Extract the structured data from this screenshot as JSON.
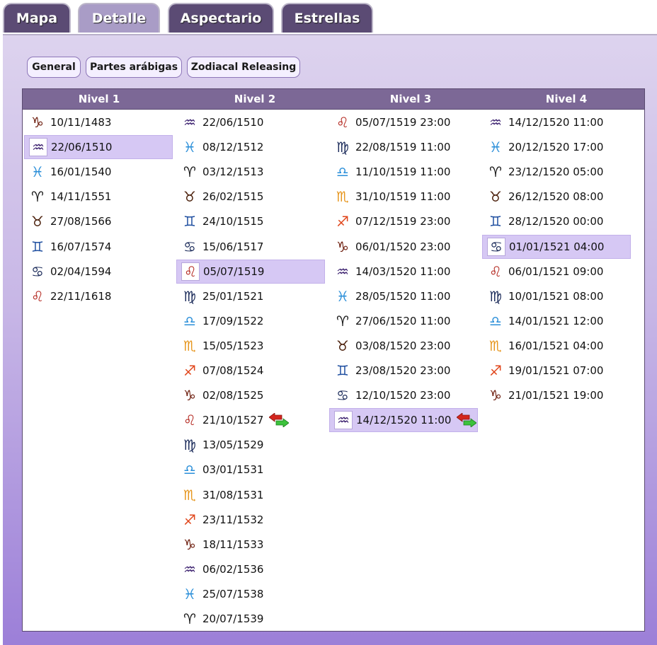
{
  "tabs": [
    {
      "label": "Mapa",
      "active": false
    },
    {
      "label": "Detalle",
      "active": true
    },
    {
      "label": "Aspectario",
      "active": false
    },
    {
      "label": "Estrellas",
      "active": false
    }
  ],
  "subtabs": [
    "General",
    "Partes arábigas",
    "Zodiacal Releasing"
  ],
  "columns": [
    "Nivel 1",
    "Nivel 2",
    "Nivel 3",
    "Nivel 4"
  ],
  "signs": {
    "capricorn": {
      "glyph": "♑",
      "color": "#6b1a0a"
    },
    "aquarius": {
      "glyph": "♒",
      "color": "#3a1f6e"
    },
    "pisces": {
      "glyph": "♓",
      "color": "#2b8fd9"
    },
    "aries": {
      "glyph": "♈",
      "color": "#1a1a1a"
    },
    "taurus": {
      "glyph": "♉",
      "color": "#4a1f0a"
    },
    "gemini": {
      "glyph": "♊",
      "color": "#1f4fa0"
    },
    "cancer": {
      "glyph": "♋",
      "color": "#1b2b5a"
    },
    "leo": {
      "glyph": "♌",
      "color": "#b3261e"
    },
    "virgo": {
      "glyph": "♍",
      "color": "#1b2b5a"
    },
    "libra": {
      "glyph": "♎",
      "color": "#2b8fd9"
    },
    "scorpio": {
      "glyph": "♏",
      "color": "#e6951c"
    },
    "sagittarius": {
      "glyph": "♐",
      "color": "#e0451a"
    }
  },
  "nivel1": [
    {
      "sign": "capricorn",
      "date": "10/11/1483"
    },
    {
      "sign": "aquarius",
      "date": "22/06/1510",
      "selected": true
    },
    {
      "sign": "pisces",
      "date": "16/01/1540"
    },
    {
      "sign": "aries",
      "date": "14/11/1551"
    },
    {
      "sign": "taurus",
      "date": "27/08/1566"
    },
    {
      "sign": "gemini",
      "date": "16/07/1574"
    },
    {
      "sign": "cancer",
      "date": "02/04/1594"
    },
    {
      "sign": "leo",
      "date": "22/11/1618"
    }
  ],
  "nivel2": [
    {
      "sign": "aquarius",
      "date": "22/06/1510"
    },
    {
      "sign": "pisces",
      "date": "08/12/1512"
    },
    {
      "sign": "aries",
      "date": "03/12/1513"
    },
    {
      "sign": "taurus",
      "date": "26/02/1515"
    },
    {
      "sign": "gemini",
      "date": "24/10/1515"
    },
    {
      "sign": "cancer",
      "date": "15/06/1517"
    },
    {
      "sign": "leo",
      "date": "05/07/1519",
      "selected": true
    },
    {
      "sign": "virgo",
      "date": "25/01/1521"
    },
    {
      "sign": "libra",
      "date": "17/09/1522"
    },
    {
      "sign": "scorpio",
      "date": "15/05/1523"
    },
    {
      "sign": "sagittarius",
      "date": "07/08/1524"
    },
    {
      "sign": "capricorn",
      "date": "02/08/1525"
    },
    {
      "sign": "leo",
      "date": "21/10/1527",
      "swap": true
    },
    {
      "sign": "virgo",
      "date": "13/05/1529"
    },
    {
      "sign": "libra",
      "date": "03/01/1531"
    },
    {
      "sign": "scorpio",
      "date": "31/08/1531"
    },
    {
      "sign": "sagittarius",
      "date": "23/11/1532"
    },
    {
      "sign": "capricorn",
      "date": "18/11/1533"
    },
    {
      "sign": "aquarius",
      "date": "06/02/1536"
    },
    {
      "sign": "pisces",
      "date": "25/07/1538"
    },
    {
      "sign": "aries",
      "date": "20/07/1539"
    }
  ],
  "nivel3": [
    {
      "sign": "leo",
      "date": "05/07/1519 23:00"
    },
    {
      "sign": "virgo",
      "date": "22/08/1519 11:00"
    },
    {
      "sign": "libra",
      "date": "11/10/1519 11:00"
    },
    {
      "sign": "scorpio",
      "date": "31/10/1519 11:00"
    },
    {
      "sign": "sagittarius",
      "date": "07/12/1519 23:00"
    },
    {
      "sign": "capricorn",
      "date": "06/01/1520 23:00"
    },
    {
      "sign": "aquarius",
      "date": "14/03/1520 11:00"
    },
    {
      "sign": "pisces",
      "date": "28/05/1520 11:00"
    },
    {
      "sign": "aries",
      "date": "27/06/1520 11:00"
    },
    {
      "sign": "taurus",
      "date": "03/08/1520 23:00"
    },
    {
      "sign": "gemini",
      "date": "23/08/1520 23:00"
    },
    {
      "sign": "cancer",
      "date": "12/10/1520 23:00"
    },
    {
      "sign": "aquarius",
      "date": "14/12/1520 11:00",
      "selected": true,
      "swap": true
    }
  ],
  "nivel4": [
    {
      "sign": "aquarius",
      "date": "14/12/1520 11:00"
    },
    {
      "sign": "pisces",
      "date": "20/12/1520 17:00"
    },
    {
      "sign": "aries",
      "date": "23/12/1520 05:00"
    },
    {
      "sign": "taurus",
      "date": "26/12/1520 08:00"
    },
    {
      "sign": "gemini",
      "date": "28/12/1520 00:00"
    },
    {
      "sign": "cancer",
      "date": "01/01/1521 04:00",
      "selected": true
    },
    {
      "sign": "leo",
      "date": "06/01/1521 09:00"
    },
    {
      "sign": "virgo",
      "date": "10/01/1521 08:00"
    },
    {
      "sign": "libra",
      "date": "14/01/1521 12:00"
    },
    {
      "sign": "scorpio",
      "date": "16/01/1521 04:00"
    },
    {
      "sign": "sagittarius",
      "date": "19/01/1521 07:00"
    },
    {
      "sign": "capricorn",
      "date": "21/01/1521 19:00"
    }
  ]
}
